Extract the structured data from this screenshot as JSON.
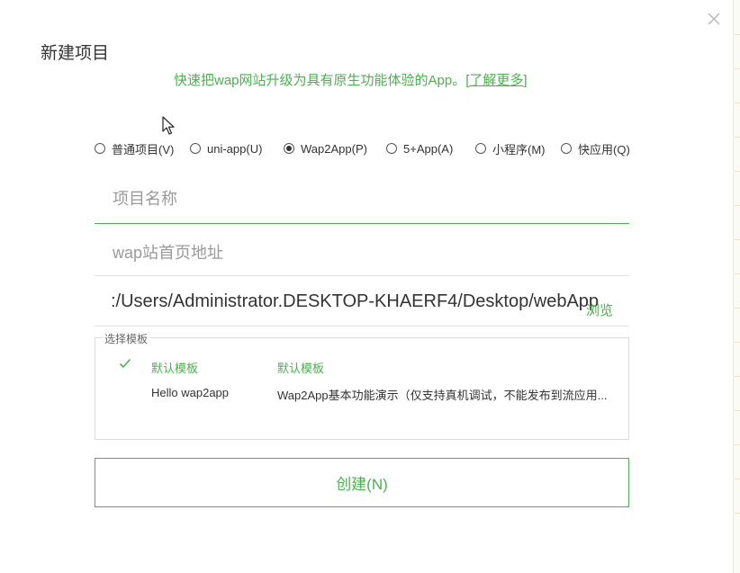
{
  "dialog": {
    "title": "新建项目",
    "subtitle": "快速把wap网站升级为具有原生功能体验的App。",
    "learn_more": "[了解更多]"
  },
  "project_types": [
    {
      "label": "普通项目(V)",
      "selected": false
    },
    {
      "label": "uni-app(U)",
      "selected": false
    },
    {
      "label": "Wap2App(P)",
      "selected": true
    },
    {
      "label": "5+App(A)",
      "selected": false
    },
    {
      "label": "小程序(M)",
      "selected": false
    },
    {
      "label": "快应用(Q)",
      "selected": false
    }
  ],
  "form": {
    "name_placeholder": "项目名称",
    "url_placeholder": "wap站首页地址",
    "location": ":/Users/Administrator.DESKTOP-KHAERF4/Desktop/webApp",
    "browse_label": "浏览"
  },
  "templates": {
    "legend": "选择模板",
    "rows": [
      {
        "name": "默认模板",
        "description": "默认模板",
        "selected": true
      },
      {
        "name": "Hello wap2app",
        "description": "Wap2App基本功能演示（仅支持真机调试，不能发布到流应用...",
        "selected": false
      }
    ]
  },
  "create_button": "创建(N)",
  "colors": {
    "accent": "#4caf50",
    "text": "#333333",
    "placeholder": "#9a9a9a"
  },
  "icons": [
    "close-icon",
    "mouse-cursor-icon",
    "checkmark-icon"
  ]
}
